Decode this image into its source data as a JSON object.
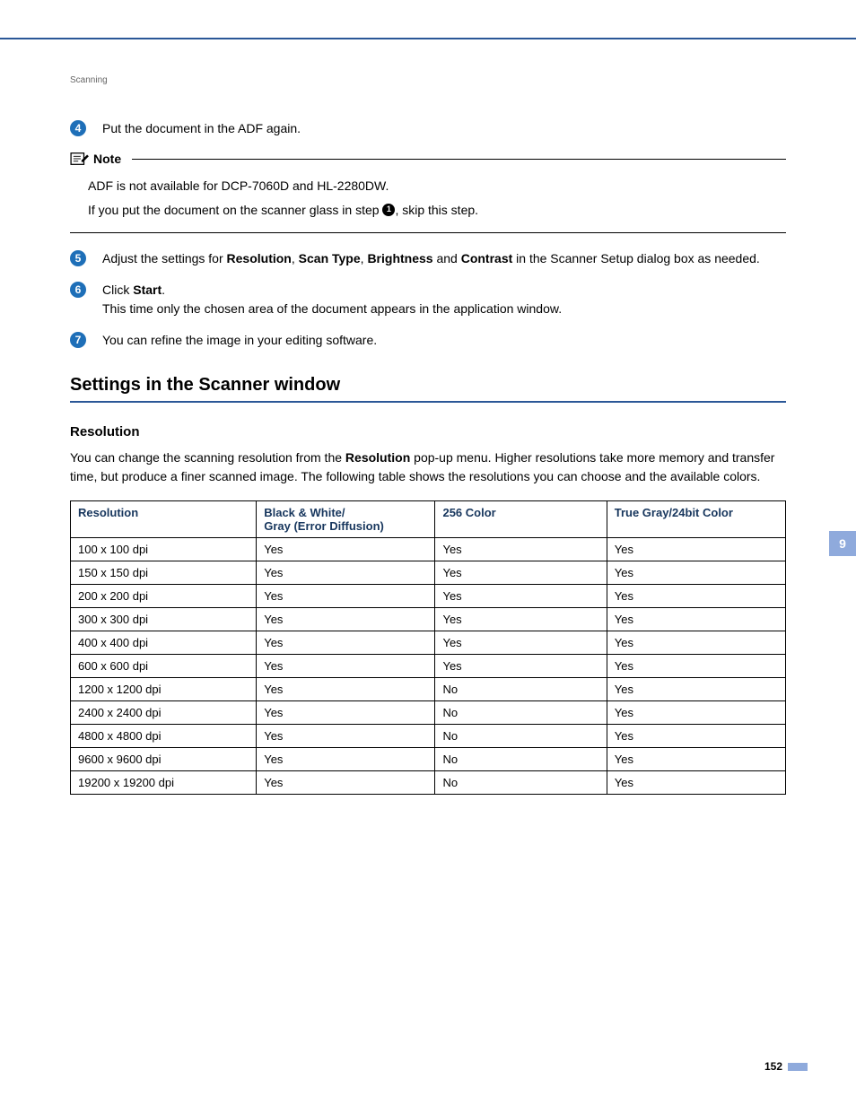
{
  "running_head": "Scanning",
  "steps": {
    "s4": {
      "num": "4",
      "text": "Put the document in the ADF again."
    },
    "s5": {
      "num": "5",
      "pre": "Adjust the settings for ",
      "b1": "Resolution",
      "sep1": ", ",
      "b2": "Scan Type",
      "sep2": ", ",
      "b3": "Brightness",
      "sep3": " and ",
      "b4": "Contrast",
      "post": " in the Scanner Setup dialog box as needed."
    },
    "s6": {
      "num": "6",
      "pre": "Click ",
      "b1": "Start",
      "post": ".",
      "line2": "This time only the chosen area of the document appears in the application window."
    },
    "s7": {
      "num": "7",
      "text": "You can refine the image in your editing software."
    }
  },
  "note": {
    "label": "Note",
    "line1": "ADF is not available for DCP-7060D and HL-2280DW.",
    "line2a": "If you put the document on the scanner glass in step ",
    "bullet": "1",
    "line2b": ", skip this step."
  },
  "h2": "Settings in the Scanner window",
  "h3": "Resolution",
  "para_a": "You can change the scanning resolution from the ",
  "para_b": "Resolution",
  "para_c": " pop-up menu. Higher resolutions take more memory and transfer time, but produce a finer scanned image. The following table shows the resolutions you can choose and the available colors.",
  "table": {
    "headers": [
      "Resolution",
      "Black & White/\nGray (Error Diffusion)",
      "256 Color",
      "True Gray/24bit Color"
    ],
    "rows": [
      [
        "100 x 100 dpi",
        "Yes",
        "Yes",
        "Yes"
      ],
      [
        "150 x 150 dpi",
        "Yes",
        "Yes",
        "Yes"
      ],
      [
        "200 x 200 dpi",
        "Yes",
        "Yes",
        "Yes"
      ],
      [
        "300 x 300 dpi",
        "Yes",
        "Yes",
        "Yes"
      ],
      [
        "400 x 400 dpi",
        "Yes",
        "Yes",
        "Yes"
      ],
      [
        "600 x 600 dpi",
        "Yes",
        "Yes",
        "Yes"
      ],
      [
        "1200 x 1200 dpi",
        "Yes",
        "No",
        "Yes"
      ],
      [
        "2400 x 2400 dpi",
        "Yes",
        "No",
        "Yes"
      ],
      [
        "4800 x 4800 dpi",
        "Yes",
        "No",
        "Yes"
      ],
      [
        "9600 x 9600 dpi",
        "Yes",
        "No",
        "Yes"
      ],
      [
        "19200 x 19200 dpi",
        "Yes",
        "No",
        "Yes"
      ]
    ]
  },
  "side_tab": "9",
  "page_number": "152"
}
